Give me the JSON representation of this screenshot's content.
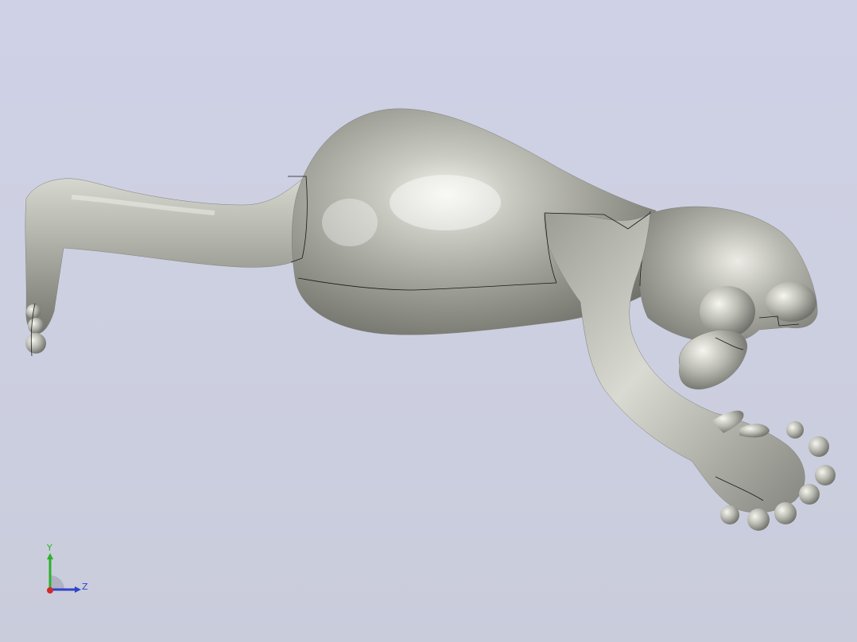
{
  "viewport": {
    "background_top": "#cfd1e7",
    "background_bottom": "#c9ccdb",
    "model_color": "#a5a69d",
    "edge_color": "#1a1a1a"
  },
  "triad": {
    "y_label": "Y",
    "z_label": "Z",
    "x_color": "#d22a2a",
    "y_color": "#2bb12b",
    "z_color": "#2f43c9"
  }
}
